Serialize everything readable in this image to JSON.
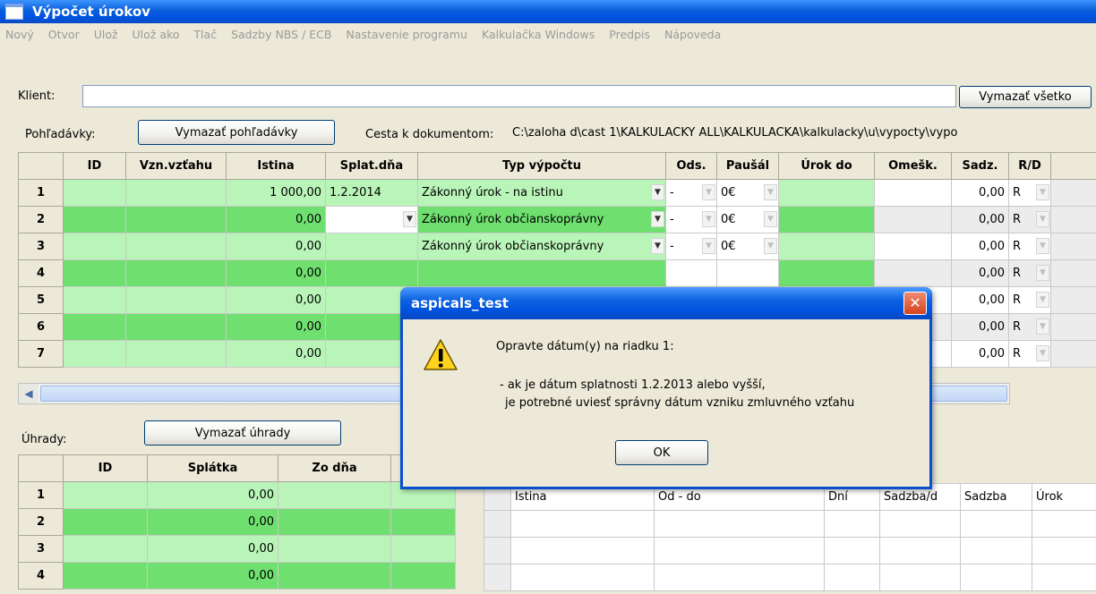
{
  "window": {
    "title": "Výpočet úrokov"
  },
  "menu": [
    "Nový",
    "Otvor",
    "Ulož",
    "Ulož ako",
    "Tlač",
    "Sadzby NBS / ECB",
    "Nastavenie programu",
    "Kalkulačka Windows",
    "Predpis",
    "Nápoveda"
  ],
  "client": {
    "label": "Klient:",
    "value": "",
    "clear_all_label": "Vymazať všetko"
  },
  "claims": {
    "label": "Pohľadávky:",
    "clear_label": "Vymazať pohľadávky",
    "path_label": "Cesta k dokumentom:",
    "path_value": "C:\\zaloha d\\cast 1\\KALKULACKY ALL\\KALKULACKA\\kalkulacky\\u\\vypocty\\vypo",
    "columns": [
      "ID",
      "Vzn.vzťahu",
      "Istina",
      "Splat.dňa",
      "Typ výpočtu",
      "Ods.",
      "Paušál",
      "Úrok do",
      "Omešk.",
      "Sadz.",
      "R/D"
    ],
    "rows": [
      {
        "n": "1",
        "istina": "1 000,00",
        "splat": "1.2.2014",
        "typ": "Zákonný úrok - na istinu",
        "ods": "-",
        "pausal": "0€",
        "sadz": "0,00",
        "rd": "R"
      },
      {
        "n": "2",
        "istina": "0,00",
        "splat": "",
        "typ": "Zákonný úrok občianskoprávny",
        "ods": "-",
        "pausal": "0€",
        "sadz": "0,00",
        "rd": "R"
      },
      {
        "n": "3",
        "istina": "0,00",
        "splat": "",
        "typ": "Zákonný úrok občianskoprávny",
        "ods": "-",
        "pausal": "0€",
        "sadz": "0,00",
        "rd": "R"
      },
      {
        "n": "4",
        "istina": "0,00",
        "splat": "",
        "typ": "",
        "ods": "",
        "pausal": "",
        "sadz": "0,00",
        "rd": "R"
      },
      {
        "n": "5",
        "istina": "0,00",
        "splat": "",
        "typ": "",
        "ods": "",
        "pausal": "",
        "sadz": "0,00",
        "rd": "R"
      },
      {
        "n": "6",
        "istina": "0,00",
        "splat": "",
        "typ": "",
        "ods": "",
        "pausal": "",
        "sadz": "0,00",
        "rd": "R"
      },
      {
        "n": "7",
        "istina": "0,00",
        "splat": "",
        "typ": "",
        "ods": "",
        "pausal": "",
        "sadz": "0,00",
        "rd": "R"
      }
    ]
  },
  "payments": {
    "label": "Úhrady:",
    "clear_label": "Vymazať úhrady",
    "columns": [
      "ID",
      "Splátka",
      "Zo dňa"
    ],
    "rows": [
      {
        "n": "1",
        "splatka": "0,00"
      },
      {
        "n": "2",
        "splatka": "0,00"
      },
      {
        "n": "3",
        "splatka": "0,00"
      },
      {
        "n": "4",
        "splatka": "0,00"
      }
    ]
  },
  "results": {
    "columns": [
      "Istina",
      "Od - do",
      "Dní",
      "Sadzba/d",
      "Sadzba",
      "Úrok"
    ]
  },
  "dialog": {
    "title": "aspicals_test",
    "line1": "Opravte dátum(y) na riadku  1:",
    "line2": "- ak je dátum splatnosti 1.2.2013 alebo vyšší,",
    "line3": "je potrebné uviesť správny dátum vzniku zmluvného vzťahu",
    "ok_label": "OK"
  }
}
